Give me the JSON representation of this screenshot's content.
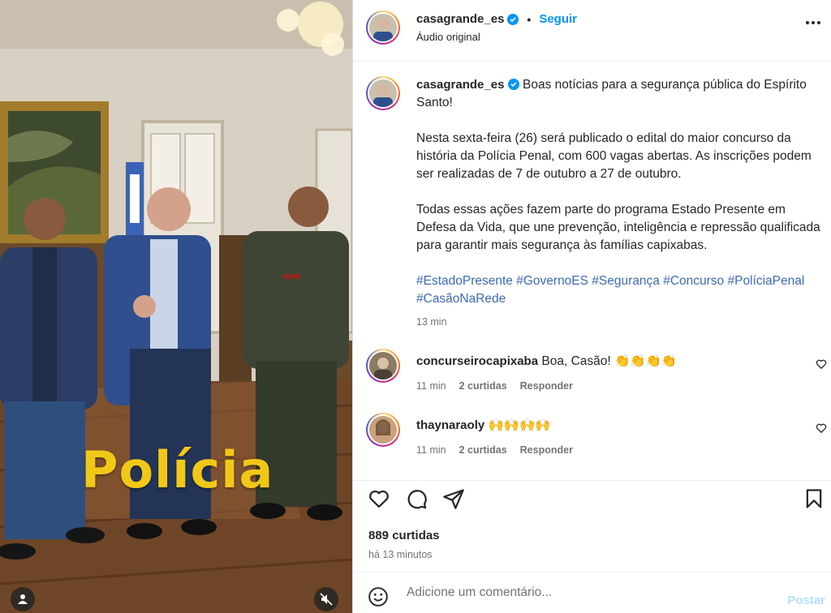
{
  "post": {
    "author": "casagrande_es",
    "verified": true,
    "follow_label": "Seguir",
    "audio": "Áudio original",
    "media_overlay_text": "Polícia"
  },
  "caption": {
    "author": "casagrande_es",
    "line1": "Boas notícias para a segurança pública do Espírito Santo!",
    "paragraph2": "Nesta sexta-feira (26) será publicado o edital do maior concurso da história da Polícia Penal, com 600 vagas abertas. As inscrições podem ser realizadas de 7 de outubro a 27 de outubro.",
    "paragraph3": "Todas essas ações fazem parte do programa Estado Presente em Defesa da Vida, que une prevenção, inteligência e repressão qualificada para garantir mais segurança às famílias capixabas.",
    "hashtags": [
      "#EstadoPresente",
      "#GovernoES",
      "#Segurança",
      "#Concurso",
      "#PolíciaPenal",
      "#CasãoNaRede"
    ],
    "time": "13 min"
  },
  "comments": [
    {
      "author": "concurseirocapixaba",
      "text": "Boa, Casão! 👏👏👏👏",
      "time": "11 min",
      "likes": "2 curtidas",
      "reply": "Responder"
    },
    {
      "author": "thaynaraoly",
      "text": "🙌🙌🙌🙌",
      "time": "11 min",
      "likes": "2 curtidas",
      "reply": "Responder"
    }
  ],
  "stats": {
    "likes": "889 curtidas",
    "posted": "há 13 minutos"
  },
  "composer": {
    "placeholder": "Adicione um comentário...",
    "post_label": "Postar"
  },
  "colors": {
    "link_blue": "#0095f6",
    "hashtag": "#3d6bb3",
    "overlay_yellow": "#f2c818",
    "post_disabled": "#b2dffc"
  },
  "icons": [
    "verified-badge-icon",
    "more-options-icon",
    "heart-icon",
    "comment-icon",
    "share-icon",
    "bookmark-icon",
    "emoji-icon",
    "user-tag-icon",
    "mute-icon"
  ]
}
